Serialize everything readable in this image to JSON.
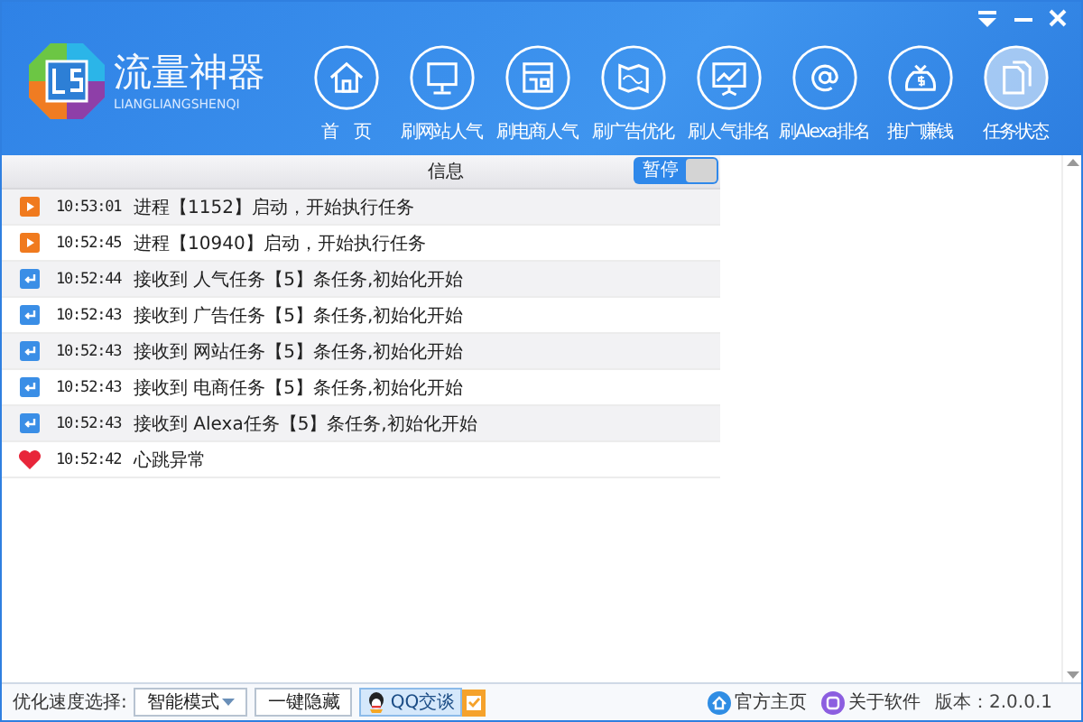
{
  "app": {
    "name": "流量神器",
    "subtitle": "LIANGLIANGSHENQI"
  },
  "nav": [
    {
      "label": "首　页",
      "selected": false
    },
    {
      "label": "刷网站人气",
      "selected": false
    },
    {
      "label": "刷电商人气",
      "selected": false
    },
    {
      "label": "刷广告优化",
      "selected": false
    },
    {
      "label": "刷人气排名",
      "selected": false
    },
    {
      "label": "刷Alexa排名",
      "selected": false
    },
    {
      "label": "推广赚钱",
      "selected": false
    },
    {
      "label": "任务状态",
      "selected": true
    }
  ],
  "log": {
    "column": "信息",
    "pause_button": "暂停",
    "rows": [
      {
        "kind": "process",
        "time": "10:53:01",
        "message": "进程【1152】启动，开始执行任务"
      },
      {
        "kind": "process",
        "time": "10:52:45",
        "message": "进程【10940】启动，开始执行任务"
      },
      {
        "kind": "receive",
        "time": "10:52:44",
        "message": "接收到 人气任务【5】条任务,初始化开始"
      },
      {
        "kind": "receive",
        "time": "10:52:43",
        "message": "接收到 广告任务【5】条任务,初始化开始"
      },
      {
        "kind": "receive",
        "time": "10:52:43",
        "message": "接收到 网站任务【5】条任务,初始化开始"
      },
      {
        "kind": "receive",
        "time": "10:52:43",
        "message": "接收到 电商任务【5】条任务,初始化开始"
      },
      {
        "kind": "receive",
        "time": "10:52:43",
        "message": "接收到 Alexa任务【5】条任务,初始化开始"
      },
      {
        "kind": "heartbeat",
        "time": "10:52:42",
        "message": "心跳异常"
      }
    ]
  },
  "status_bar": {
    "speed_label": "优化速度选择:",
    "speed_value": "智能模式",
    "hide_button": "一键隐藏",
    "qq_button": "QQ交谈",
    "homepage_link": "官方主页",
    "about_link": "关于软件",
    "version": "版本：2.0.0.1"
  }
}
